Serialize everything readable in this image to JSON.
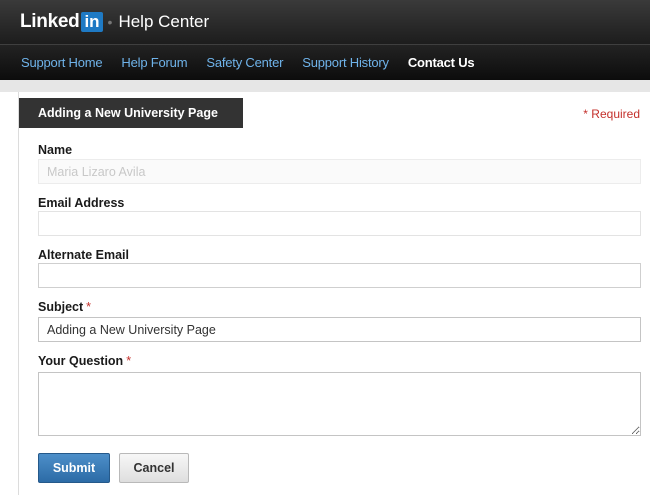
{
  "header": {
    "logo_text": "Linked",
    "logo_in": "in",
    "logo_separator": "•",
    "title": "Help Center"
  },
  "nav": {
    "items": [
      {
        "label": "Support Home",
        "active": false
      },
      {
        "label": "Help Forum",
        "active": false
      },
      {
        "label": "Safety Center",
        "active": false
      },
      {
        "label": "Support History",
        "active": false
      },
      {
        "label": "Contact Us",
        "active": true
      }
    ]
  },
  "form": {
    "tab_title": "Adding a New University Page",
    "required_note": "* Required",
    "required_star": "*",
    "fields": {
      "name": {
        "label": "Name",
        "value": "Maria Lizaro Avila"
      },
      "email": {
        "label": "Email Address",
        "value": ""
      },
      "alt_email": {
        "label": "Alternate Email",
        "value": ""
      },
      "subject": {
        "label": "Subject",
        "value": "Adding a New University Page"
      },
      "question": {
        "label": "Your Question",
        "value": ""
      }
    },
    "submit_label": "Submit",
    "cancel_label": "Cancel"
  },
  "colors": {
    "accent": "#2c6ba6",
    "nav_link": "#6fb3ea",
    "required": "#c4302b",
    "header_bg": "#1d1d1d"
  }
}
